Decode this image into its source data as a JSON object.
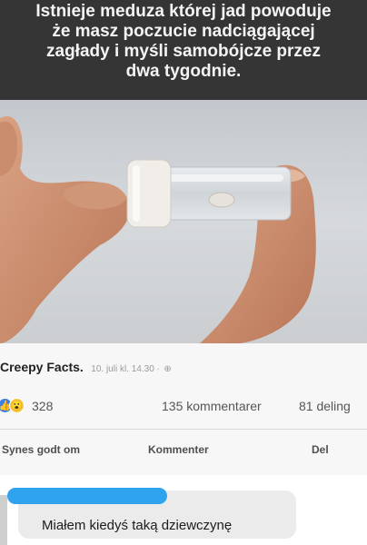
{
  "meme": {
    "caption_lines": [
      "Istnieje meduza której jad powoduje",
      "że masz poczucie nadciągającej",
      "zagłady i myśli samobójcze przez",
      "dwa tygodnie."
    ]
  },
  "post": {
    "page_name": "Creepy Facts.",
    "timestamp": "10. juli kl. 14.30 ·",
    "privacy_icon": "globe-icon"
  },
  "stats": {
    "reaction_icons": [
      "like-icon",
      "wow-icon"
    ],
    "reaction_count": "328",
    "comments": "135 kommentarer",
    "shares": "81 deling"
  },
  "actions": {
    "like": "Synes godt om",
    "comment": "Kommenter",
    "share": "Del"
  },
  "comment": {
    "text": "Miałem kiedyś taką dziewczynę"
  },
  "colors": {
    "banner": "#353535",
    "banner_text": "#f4f4f4",
    "name_redaction": "#2fa3ee",
    "comment_bubble": "#ebebeb"
  }
}
